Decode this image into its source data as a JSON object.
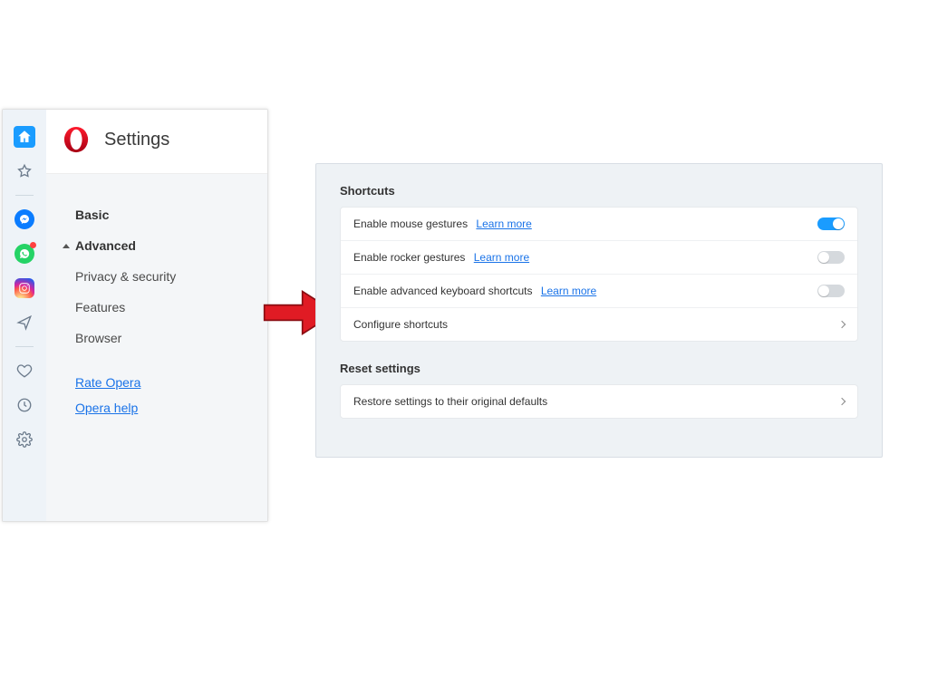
{
  "sidebar": {
    "title": "Settings",
    "nav": {
      "basic": "Basic",
      "advanced": "Advanced",
      "privacy": "Privacy & security",
      "features": "Features",
      "browser": "Browser"
    },
    "links": {
      "rate": "Rate Opera",
      "help": "Opera help"
    },
    "rail_icons": {
      "home": "home-icon",
      "speeddial": "star-outline-icon",
      "messenger": "messenger-icon",
      "whatsapp": "whatsapp-icon",
      "instagram": "instagram-icon",
      "send": "send-icon",
      "heart": "heart-outline-icon",
      "history": "clock-icon",
      "settings": "gear-icon"
    }
  },
  "content": {
    "shortcuts": {
      "title": "Shortcuts",
      "mouse_gestures": "Enable mouse gestures",
      "rocker_gestures": "Enable rocker gestures",
      "keyboard_shortcuts": "Enable advanced keyboard shortcuts",
      "configure": "Configure shortcuts",
      "learn_more": "Learn more",
      "toggles": {
        "mouse_gestures": true,
        "rocker_gestures": false,
        "keyboard_shortcuts": false
      }
    },
    "reset": {
      "title": "Reset settings",
      "restore": "Restore settings to their original defaults"
    }
  },
  "colors": {
    "accent": "#1a9cff",
    "link": "#1a73e8",
    "arrow": "#e01b24"
  }
}
